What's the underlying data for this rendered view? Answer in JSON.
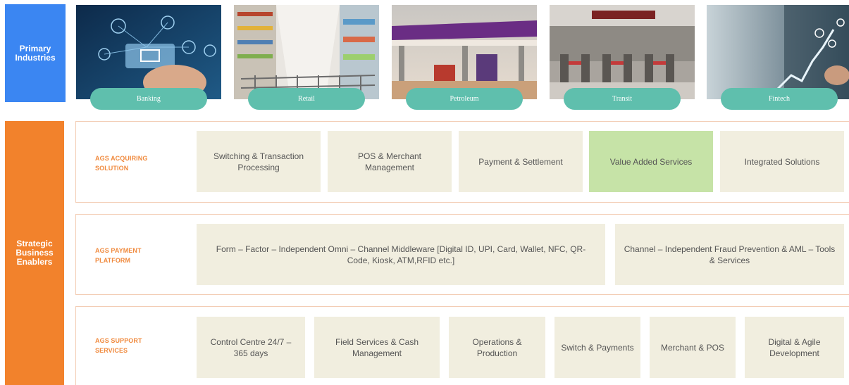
{
  "primary_label": "Primary Industries",
  "strategic_label": "Strategic Business Enablers",
  "industries": [
    {
      "label": "Banking",
      "icon": "banking-image"
    },
    {
      "label": "Retail",
      "icon": "retail-image"
    },
    {
      "label": "Petroleum",
      "icon": "petroleum-image"
    },
    {
      "label": "Transit",
      "icon": "transit-image"
    },
    {
      "label": "Fintech",
      "icon": "fintech-image"
    }
  ],
  "acquiring": {
    "label": "AGS ACQUIRING SOLUTION",
    "items": [
      "Switching & Transaction Processing",
      "POS & Merchant Management",
      "Payment & Settlement",
      "Value Added Services",
      "Integrated Solutions"
    ]
  },
  "payment": {
    "label": "AGS PAYMENT PLATFORM",
    "items": [
      "Form – Factor – Independent Omni – Channel Middleware [Digital ID, UPI, Card, Wallet, NFC, QR-Code, Kiosk, ATM,RFID etc.]",
      "Channel – Independent  Fraud Prevention & AML – Tools & Services"
    ]
  },
  "support": {
    "label": "AGS SUPPORT SERVICES",
    "items": [
      "Control Centre 24/7 – 365 days",
      "Field Services & Cash Management",
      "Operations & Production",
      "Switch & Payments",
      "Merchant & POS",
      "Digital & Agile Development"
    ]
  },
  "colors": {
    "primary": "#3b86f2",
    "strategic": "#f2822c",
    "pill": "#5fbfad",
    "box": "#f1eedf",
    "highlight": "#c6e3a7",
    "label": "#f08a3e"
  }
}
